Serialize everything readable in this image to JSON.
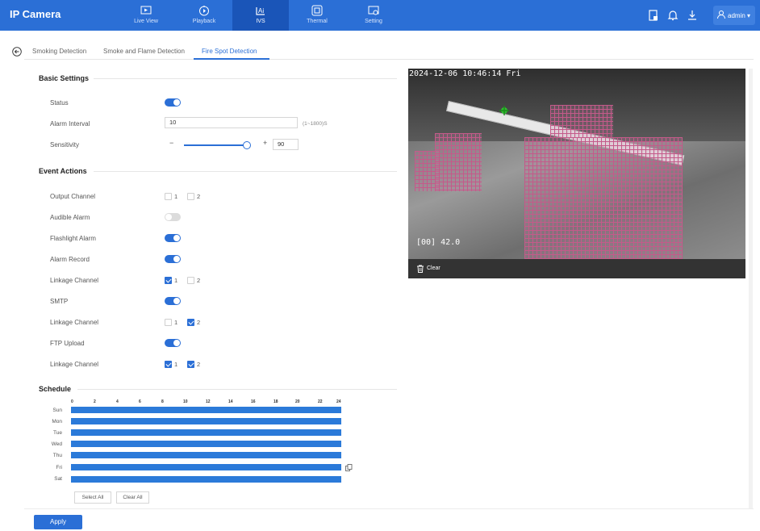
{
  "app": {
    "title": "IP Camera"
  },
  "nav": [
    {
      "label": "Live View",
      "icon": "live-view-icon"
    },
    {
      "label": "Playback",
      "icon": "playback-icon"
    },
    {
      "label": "IVS",
      "icon": "ivs-icon",
      "active": true
    },
    {
      "label": "Thermal",
      "icon": "thermal-icon"
    },
    {
      "label": "Setting",
      "icon": "setting-icon"
    }
  ],
  "user": {
    "name": "admin ▾"
  },
  "tabs": [
    {
      "label": "Smoking Detection"
    },
    {
      "label": "Smoke and Flame Detection"
    },
    {
      "label": "Fire Spot Detection",
      "active": true
    }
  ],
  "basic": {
    "title": "Basic Settings",
    "status_label": "Status",
    "status_on": true,
    "interval_label": "Alarm Interval",
    "interval_value": "10",
    "interval_hint": "(1~1800)S",
    "sensitivity_label": "Sensitivity",
    "sensitivity_value": "90",
    "minus": "−",
    "plus": "+"
  },
  "events": {
    "title": "Event Actions",
    "output_label": "Output Channel",
    "audible_label": "Audible Alarm",
    "flash_label": "Flashlight Alarm",
    "record_label": "Alarm Record",
    "link1_label": "Linkage Channel",
    "smtp_label": "SMTP",
    "link2_label": "Linkage Channel",
    "ftp_label": "FTP Upload",
    "link3_label": "Linkage Channel",
    "ch1": "1",
    "ch2": "2"
  },
  "schedule": {
    "title": "Schedule",
    "hours": [
      "0",
      "2",
      "4",
      "6",
      "8",
      "10",
      "12",
      "14",
      "16",
      "18",
      "20",
      "22",
      "24"
    ],
    "days": [
      "Sun",
      "Mon",
      "Tue",
      "Wed",
      "Thu",
      "Fri",
      "Sat"
    ],
    "select_all": "Select All",
    "clear_all": "Clear All"
  },
  "video": {
    "timestamp": "2024-12-06 10:46:14 Fri",
    "temperature": "[00] 42.0",
    "clear_label": "Clear"
  },
  "actions": {
    "apply": "Apply"
  },
  "colors": {
    "accent": "#2b6fd6",
    "topbar": "#2b6fd6",
    "zone": "#c45a8a"
  }
}
